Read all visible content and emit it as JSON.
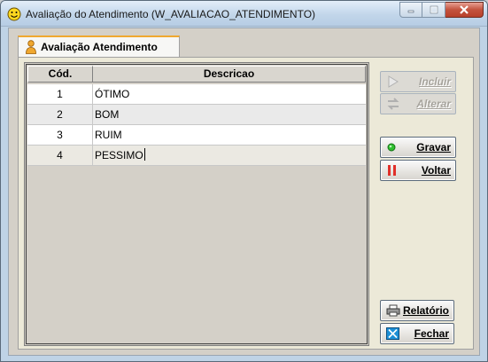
{
  "window": {
    "title": "Avaliação do Atendimento (W_AVALIACAO_ATENDIMENTO)"
  },
  "tab": {
    "label": "Avaliação Atendimento"
  },
  "grid": {
    "columns": [
      "Cód.",
      "Descricao"
    ],
    "rows": [
      {
        "cod": "1",
        "descricao": "ÓTIMO"
      },
      {
        "cod": "2",
        "descricao": "BOM"
      },
      {
        "cod": "3",
        "descricao": "RUIM"
      },
      {
        "cod": "4",
        "descricao": "PESSIMO"
      }
    ]
  },
  "buttons": {
    "incluir": "Incluir",
    "alterar": "Alterar",
    "gravar": "Gravar",
    "voltar": "Voltar",
    "relatorio": "Relatório",
    "fechar": "Fechar"
  },
  "icons": {
    "title": "smiley-icon",
    "tab": "person-icon",
    "incluir": "play-arrow-icon",
    "alterar": "swap-icon",
    "gravar": "green-dot-icon",
    "voltar": "pause-icon",
    "relatorio": "printer-icon",
    "fechar": "close-x-icon"
  }
}
